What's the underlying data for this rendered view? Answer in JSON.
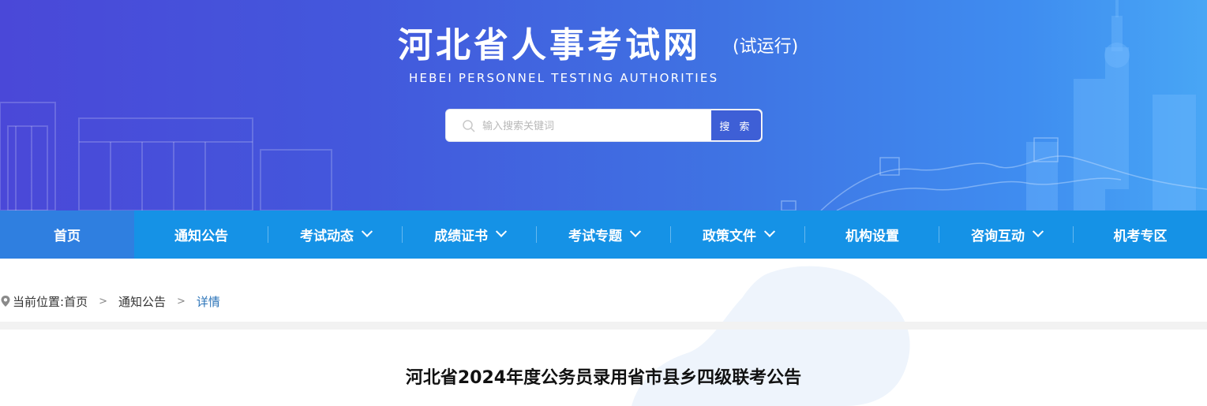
{
  "header": {
    "title": "河北省人事考试网",
    "title_tag": "(试运行)",
    "subtitle": "HEBEI  PERSONNEL  TESTING  AUTHORITIES"
  },
  "search": {
    "placeholder": "输入搜索关键词",
    "button_label": "搜 索",
    "icon": "search-icon"
  },
  "nav": {
    "items": [
      {
        "label": "首页",
        "active": true,
        "dropdown": false
      },
      {
        "label": "通知公告",
        "active": false,
        "dropdown": false
      },
      {
        "label": "考试动态",
        "active": false,
        "dropdown": true
      },
      {
        "label": "成绩证书",
        "active": false,
        "dropdown": true
      },
      {
        "label": "考试专题",
        "active": false,
        "dropdown": true
      },
      {
        "label": "政策文件",
        "active": false,
        "dropdown": true
      },
      {
        "label": "机构设置",
        "active": false,
        "dropdown": false
      },
      {
        "label": "咨询互动",
        "active": false,
        "dropdown": true
      },
      {
        "label": "机考专区",
        "active": false,
        "dropdown": false
      }
    ]
  },
  "breadcrumb": {
    "icon": "location-pin-icon",
    "prefix": "当前位置:",
    "home": "首页",
    "section": "通知公告",
    "separator": ">",
    "current": "详情"
  },
  "article": {
    "title": "河北省2024年度公务员录用省市县乡四级联考公告"
  },
  "colors": {
    "nav_bg": "#1592e6",
    "nav_active": "#2f7fe0",
    "banner_start": "#4a48d8",
    "banner_end": "#48a6f5",
    "breadcrumb_current": "#2a73b8"
  }
}
